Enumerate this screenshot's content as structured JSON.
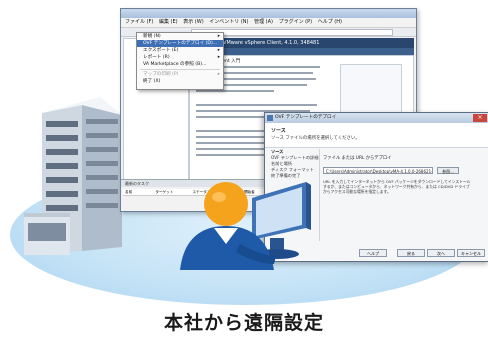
{
  "caption": "本社から遠隔設定",
  "vsphere": {
    "menubar": [
      "ファイル (F)",
      "編集 (E)",
      "表示 (W)",
      "インベントリ (N)",
      "管理 (A)",
      "プラグイン (P)",
      "ヘルプ (H)"
    ],
    "bluebar": "Tamarin.sol VMware vSphere Client, 4.1.0, 348481",
    "home_heading": "vSphere Client 入門",
    "task_panel_title": "最新のタスク",
    "task_filter": "名前、ターゲット",
    "task_columns": [
      "名前",
      "ターゲット",
      "ステータス",
      "詳細",
      "開始者"
    ],
    "status_bar": "タスク"
  },
  "file_menu": {
    "items": [
      {
        "label": "新規 (N)",
        "submenu": true,
        "state": "normal"
      },
      {
        "label": "OVF テンプレートのデプロイ (D)...",
        "submenu": false,
        "state": "highlighted"
      },
      {
        "label": "エクスポート (E)",
        "submenu": true,
        "state": "normal"
      },
      {
        "label": "レポート (R)",
        "submenu": true,
        "state": "normal"
      },
      {
        "label": "VA Marketplace の参照 (B)...",
        "submenu": false,
        "state": "normal"
      },
      {
        "label": "マップの印刷 (P)",
        "submenu": true,
        "state": "disabled"
      },
      {
        "label": "終了 (X)",
        "submenu": false,
        "state": "normal"
      }
    ]
  },
  "ovf_dialog": {
    "title": "OVF テンプレートのデプロイ",
    "section": "ソース",
    "subtitle": "ソース ファイルの場所を選択してください。",
    "steps": [
      "ソース",
      "OVF テンプレートの詳細",
      "名前と場所",
      "ディスク フォーマット",
      "終了準備の完了"
    ],
    "url_label": "ファイル または URL からデプロイ",
    "url_value": "C:\\Users\\Administrator\\Desktop\\vMA-4.1.0.0-268621-ovf\\vMA-4.1.0.0-268621.ovf",
    "browse_button": "参照...",
    "description": "URL を入力してインターネットから OVF パッケージをダウンロードしてインストールするか、またはコンピュータから、ネットワーク共有から、または CD/DVD ドライブからアクセス可能な場所を指定します。",
    "buttons": {
      "help": "ヘルプ",
      "back": "戻る",
      "next": "次へ",
      "cancel": "キャンセル"
    }
  },
  "colors": {
    "accent_blue": "#28466e",
    "menu_highlight": "#3e6fb4",
    "person_orange": "#f5a21d",
    "person_blue": "#1e5aa8",
    "ground": "#c5e3f6"
  }
}
